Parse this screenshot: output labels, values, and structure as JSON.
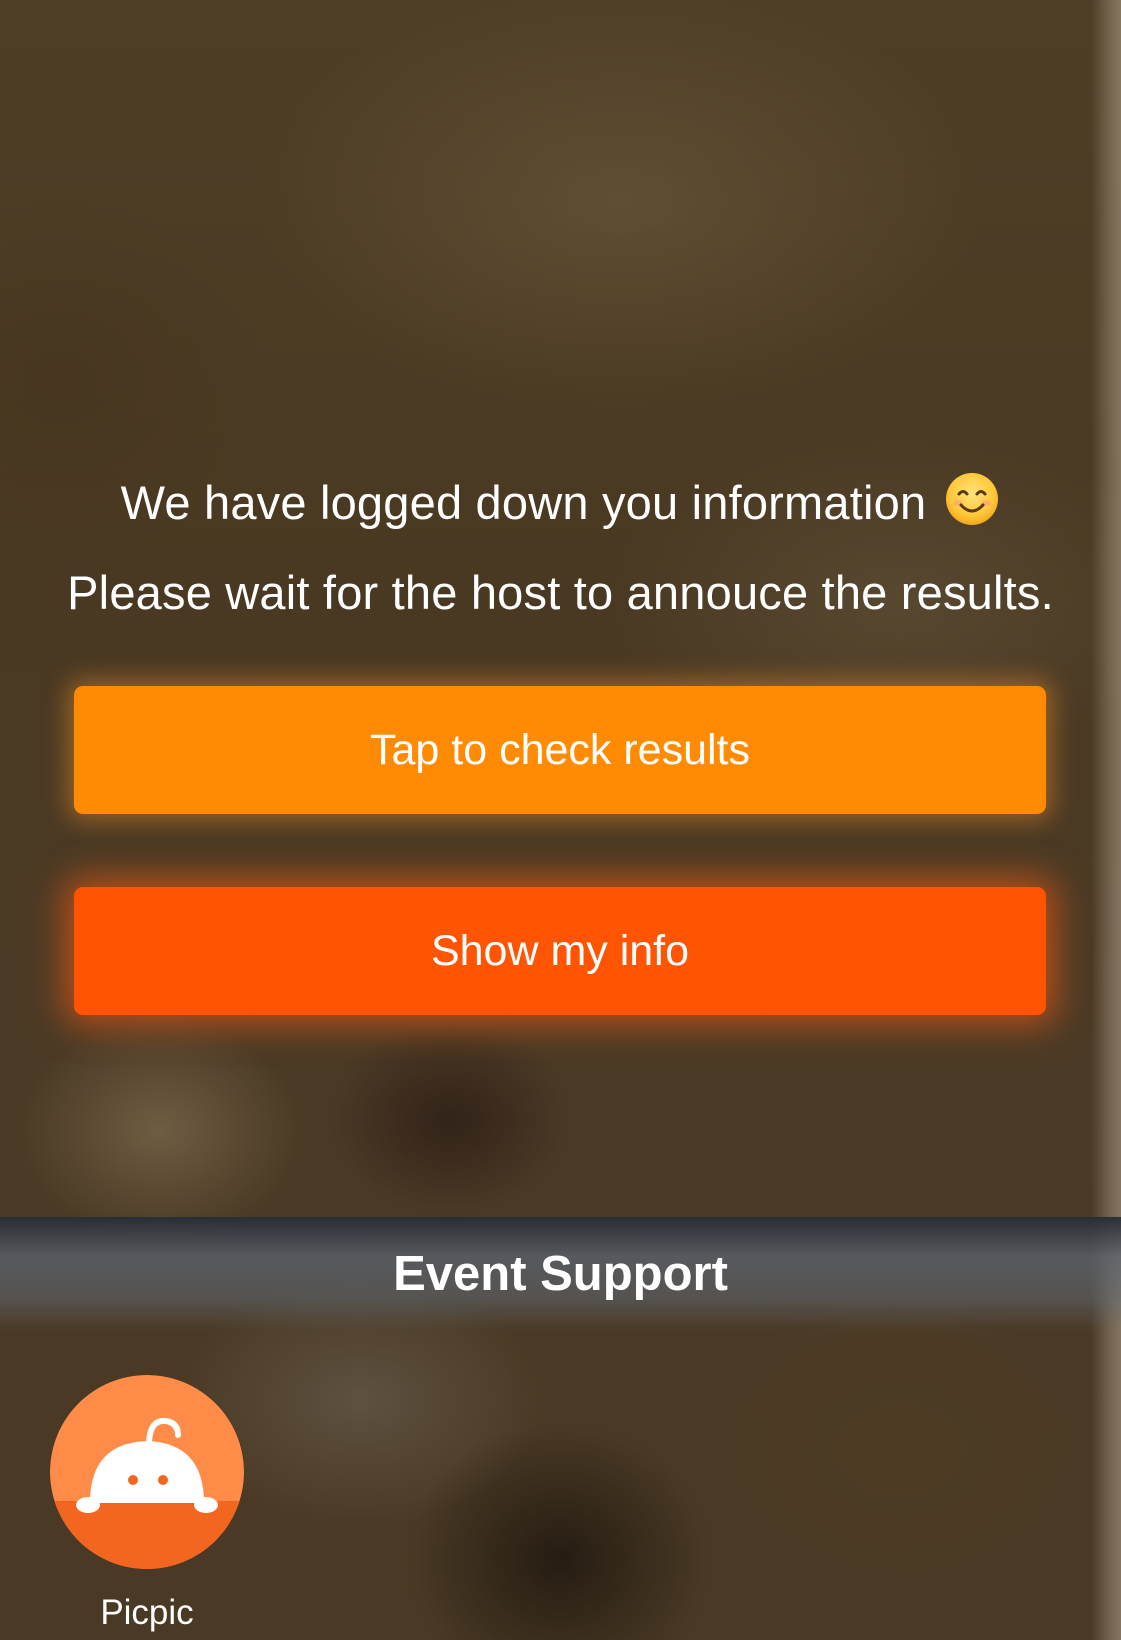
{
  "message": {
    "line1": "We have logged down you information",
    "emoji_icon": "smiling-face-emoji-icon",
    "line2": "Please wait for the host to annouce the results."
  },
  "buttons": {
    "check_results_label": "Tap to check results",
    "show_info_label": "Show my info"
  },
  "colors": {
    "check_results_button": "#ff8a04",
    "show_info_button": "#ff5503",
    "app_icon_orange": "#ff7f3a"
  },
  "event_support": {
    "title": "Event Support",
    "apps": [
      {
        "name": "Picpic",
        "icon": "picpic-app-icon"
      }
    ]
  }
}
